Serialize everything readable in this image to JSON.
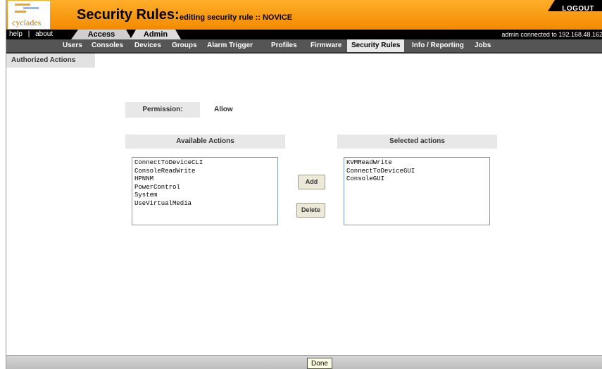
{
  "header": {
    "logo_text": "cyclades",
    "title": "Security Rules:",
    "subtitle": "editing security rule :: NOVICE",
    "logout_label": "LOGOUT"
  },
  "nav": {
    "help_label": "help",
    "separator": "|",
    "about_label": "about",
    "tabs": [
      {
        "label": "Access"
      },
      {
        "label": "Admin"
      }
    ],
    "connection_status": "admin connected to 192.168.48.162"
  },
  "subnav": {
    "items": [
      {
        "label": "Users"
      },
      {
        "label": "Consoles"
      },
      {
        "label": "Devices"
      },
      {
        "label": "Groups"
      },
      {
        "label": "Alarm Trigger"
      },
      {
        "label": "Profiles"
      },
      {
        "label": "Firmware"
      },
      {
        "label": "Security Rules"
      },
      {
        "label": "Info / Reporting"
      },
      {
        "label": "Jobs"
      }
    ],
    "active": "Security Rules"
  },
  "page": {
    "section_tab": "Authorized Actions",
    "permission_label": "Permission:",
    "permission_value": "Allow",
    "available_label": "Available Actions",
    "selected_label": "Selected actions",
    "available_actions": [
      "ConnectToDeviceCLI",
      "ConsoleReadWrite",
      "HPNNM",
      "PowerControl",
      "System",
      "UseVirtualMedia"
    ],
    "selected_actions": [
      "KVMReadWrite",
      "ConnectToDeviceGUI",
      "ConsoleGUI"
    ],
    "add_label": "Add",
    "delete_label": "Delete"
  },
  "footer": {
    "done_label": "Done"
  },
  "colors": {
    "header_orange": "#f38a00",
    "nav_black": "#000000",
    "subnav_gray": "#555555"
  }
}
